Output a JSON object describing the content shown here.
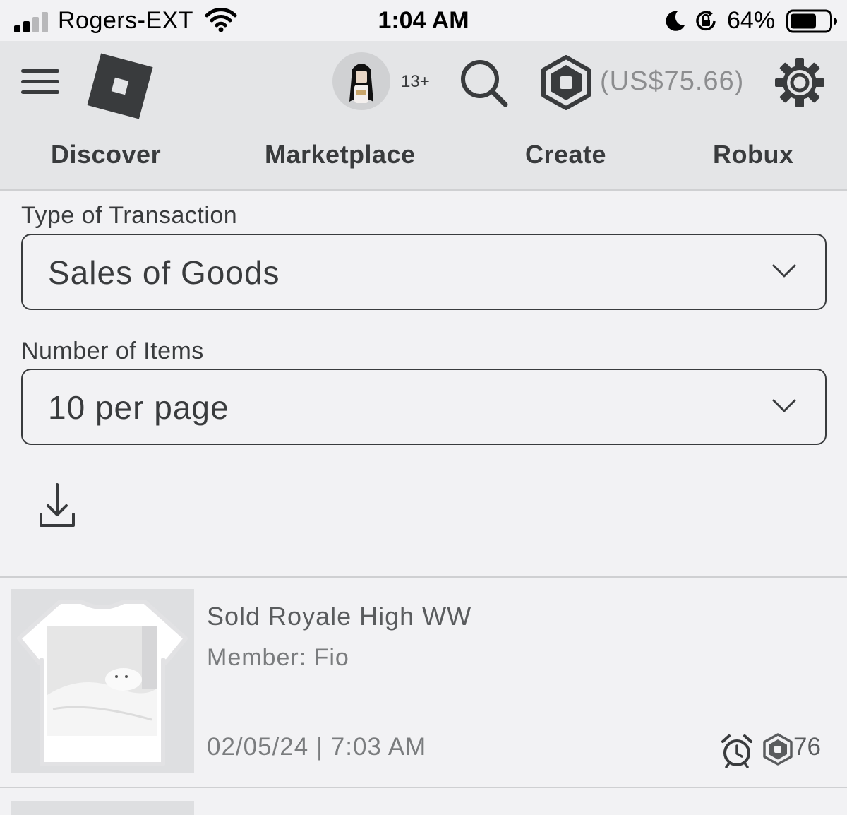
{
  "status_bar": {
    "carrier": "Rogers-EXT",
    "time": "1:04 AM",
    "battery_percent": "64%",
    "battery_level": 0.64,
    "signal_bars": 2
  },
  "header": {
    "age_label": "13+",
    "robux_value": "(US$75.66)",
    "icons": [
      "menu-icon",
      "roblox-logo",
      "avatar",
      "search-icon",
      "robux-icon",
      "gear-icon"
    ]
  },
  "nav": {
    "tabs": [
      {
        "label": "Discover"
      },
      {
        "label": "Marketplace"
      },
      {
        "label": "Create"
      },
      {
        "label": "Robux"
      }
    ]
  },
  "filters": {
    "transaction_type_label": "Type of Transaction",
    "transaction_type_value": "Sales of Goods",
    "items_label": "Number of Items",
    "items_value": "10 per page"
  },
  "transactions": [
    {
      "title": "Sold Royale High WW",
      "member": "Member: Fio",
      "date": "02/05/24 | 7:03 AM",
      "amount": "76"
    }
  ],
  "colors": {
    "header_bg": "#e4e5e7",
    "page_bg": "#f2f2f4",
    "text_dark": "#393b3d",
    "text_muted": "#7a7c7e"
  }
}
